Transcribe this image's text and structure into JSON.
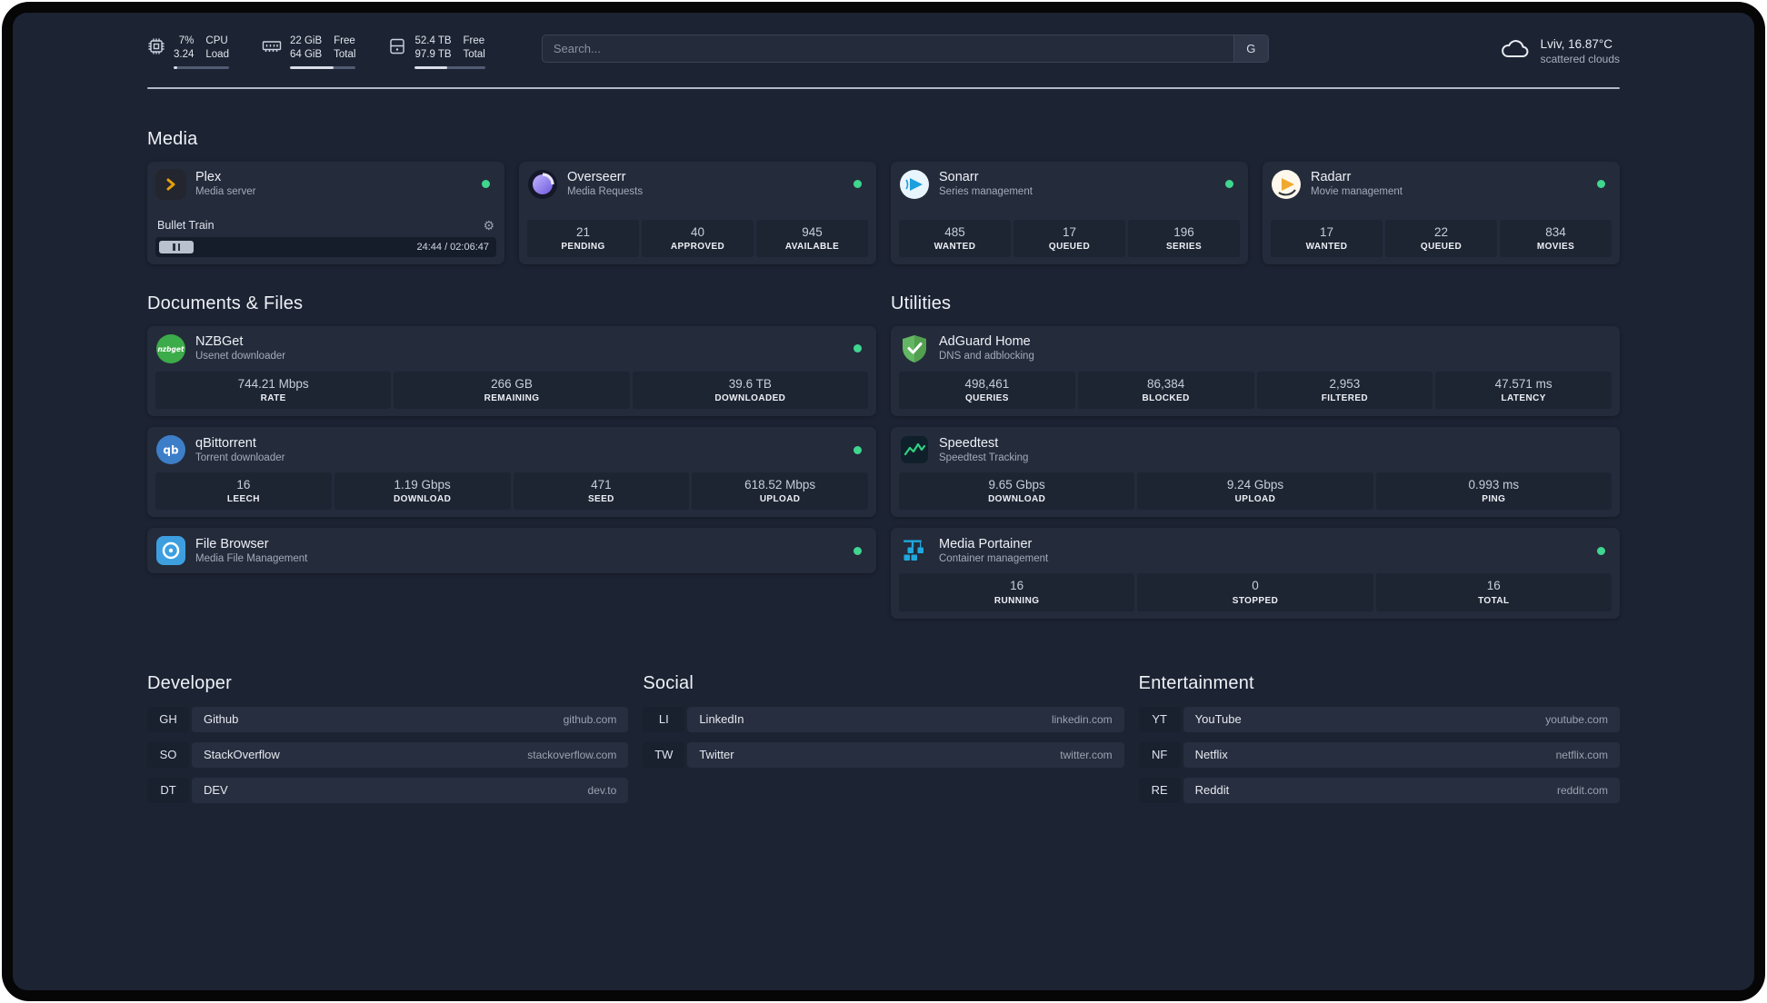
{
  "colors": {
    "accent_green": "#3fd68f",
    "background": "#1c2332",
    "card": "#242b3b",
    "tile": "#1d2432",
    "plex_gold": "#e5a00d"
  },
  "topbar": {
    "cpu": {
      "value_top": "7%",
      "value_bottom": "3.24",
      "label_top": "CPU",
      "label_bottom": "Load",
      "progress_pct": 7
    },
    "memory": {
      "value_top": "22 GiB",
      "value_bottom": "64 GiB",
      "label_top": "Free",
      "label_bottom": "Total",
      "progress_pct": 66
    },
    "disk": {
      "value_top": "52.4 TB",
      "value_bottom": "97.9 TB",
      "label_top": "Free",
      "label_bottom": "Total",
      "progress_pct": 46
    },
    "search": {
      "placeholder": "Search...",
      "provider_button": "G"
    },
    "weather": {
      "location": "Lviv, 16.87°C",
      "condition": "scattered clouds"
    }
  },
  "sections": {
    "media": {
      "title": "Media",
      "plex": {
        "name": "Plex",
        "subtitle": "Media server",
        "status": "online",
        "player": {
          "track": "Bullet Train",
          "time": "24:44 / 02:06:47"
        }
      },
      "overseerr": {
        "name": "Overseerr",
        "subtitle": "Media Requests",
        "status": "online",
        "stats": [
          {
            "value": "21",
            "label": "PENDING"
          },
          {
            "value": "40",
            "label": "APPROVED"
          },
          {
            "value": "945",
            "label": "AVAILABLE"
          }
        ]
      },
      "sonarr": {
        "name": "Sonarr",
        "subtitle": "Series management",
        "status": "online",
        "stats": [
          {
            "value": "485",
            "label": "WANTED"
          },
          {
            "value": "17",
            "label": "QUEUED"
          },
          {
            "value": "196",
            "label": "SERIES"
          }
        ]
      },
      "radarr": {
        "name": "Radarr",
        "subtitle": "Movie management",
        "status": "online",
        "stats": [
          {
            "value": "17",
            "label": "WANTED"
          },
          {
            "value": "22",
            "label": "QUEUED"
          },
          {
            "value": "834",
            "label": "MOVIES"
          }
        ]
      }
    },
    "documents": {
      "title": "Documents & Files",
      "nzbget": {
        "name": "NZBGet",
        "subtitle": "Usenet downloader",
        "status": "online",
        "icon_text": "nzbget",
        "stats": [
          {
            "value": "744.21 Mbps",
            "label": "RATE"
          },
          {
            "value": "266 GB",
            "label": "REMAINING"
          },
          {
            "value": "39.6 TB",
            "label": "DOWNLOADED"
          }
        ]
      },
      "qbittorrent": {
        "name": "qBittorrent",
        "subtitle": "Torrent downloader",
        "status": "online",
        "icon_text": "qb",
        "stats": [
          {
            "value": "16",
            "label": "LEECH"
          },
          {
            "value": "1.19 Gbps",
            "label": "DOWNLOAD"
          },
          {
            "value": "471",
            "label": "SEED"
          },
          {
            "value": "618.52 Mbps",
            "label": "UPLOAD"
          }
        ]
      },
      "filebrowser": {
        "name": "File Browser",
        "subtitle": "Media File Management",
        "status": "online"
      }
    },
    "utilities": {
      "title": "Utilities",
      "adguard": {
        "name": "AdGuard Home",
        "subtitle": "DNS and adblocking",
        "stats": [
          {
            "value": "498,461",
            "label": "QUERIES"
          },
          {
            "value": "86,384",
            "label": "BLOCKED"
          },
          {
            "value": "2,953",
            "label": "FILTERED"
          },
          {
            "value": "47.571 ms",
            "label": "LATENCY"
          }
        ]
      },
      "speedtest": {
        "name": "Speedtest",
        "subtitle": "Speedtest Tracking",
        "stats": [
          {
            "value": "9.65 Gbps",
            "label": "DOWNLOAD"
          },
          {
            "value": "9.24 Gbps",
            "label": "UPLOAD"
          },
          {
            "value": "0.993 ms",
            "label": "PING"
          }
        ]
      },
      "portainer": {
        "name": "Media Portainer",
        "subtitle": "Container management",
        "status": "online",
        "stats": [
          {
            "value": "16",
            "label": "RUNNING"
          },
          {
            "value": "0",
            "label": "STOPPED"
          },
          {
            "value": "16",
            "label": "TOTAL"
          }
        ]
      }
    },
    "developer": {
      "title": "Developer",
      "bookmarks": [
        {
          "abbr": "GH",
          "name": "Github",
          "domain": "github.com"
        },
        {
          "abbr": "SO",
          "name": "StackOverflow",
          "domain": "stackoverflow.com"
        },
        {
          "abbr": "DT",
          "name": "DEV",
          "domain": "dev.to"
        }
      ]
    },
    "social": {
      "title": "Social",
      "bookmarks": [
        {
          "abbr": "LI",
          "name": "LinkedIn",
          "domain": "linkedin.com"
        },
        {
          "abbr": "TW",
          "name": "Twitter",
          "domain": "twitter.com"
        }
      ]
    },
    "entertainment": {
      "title": "Entertainment",
      "bookmarks": [
        {
          "abbr": "YT",
          "name": "YouTube",
          "domain": "youtube.com"
        },
        {
          "abbr": "NF",
          "name": "Netflix",
          "domain": "netflix.com"
        },
        {
          "abbr": "RE",
          "name": "Reddit",
          "domain": "reddit.com"
        }
      ]
    }
  }
}
